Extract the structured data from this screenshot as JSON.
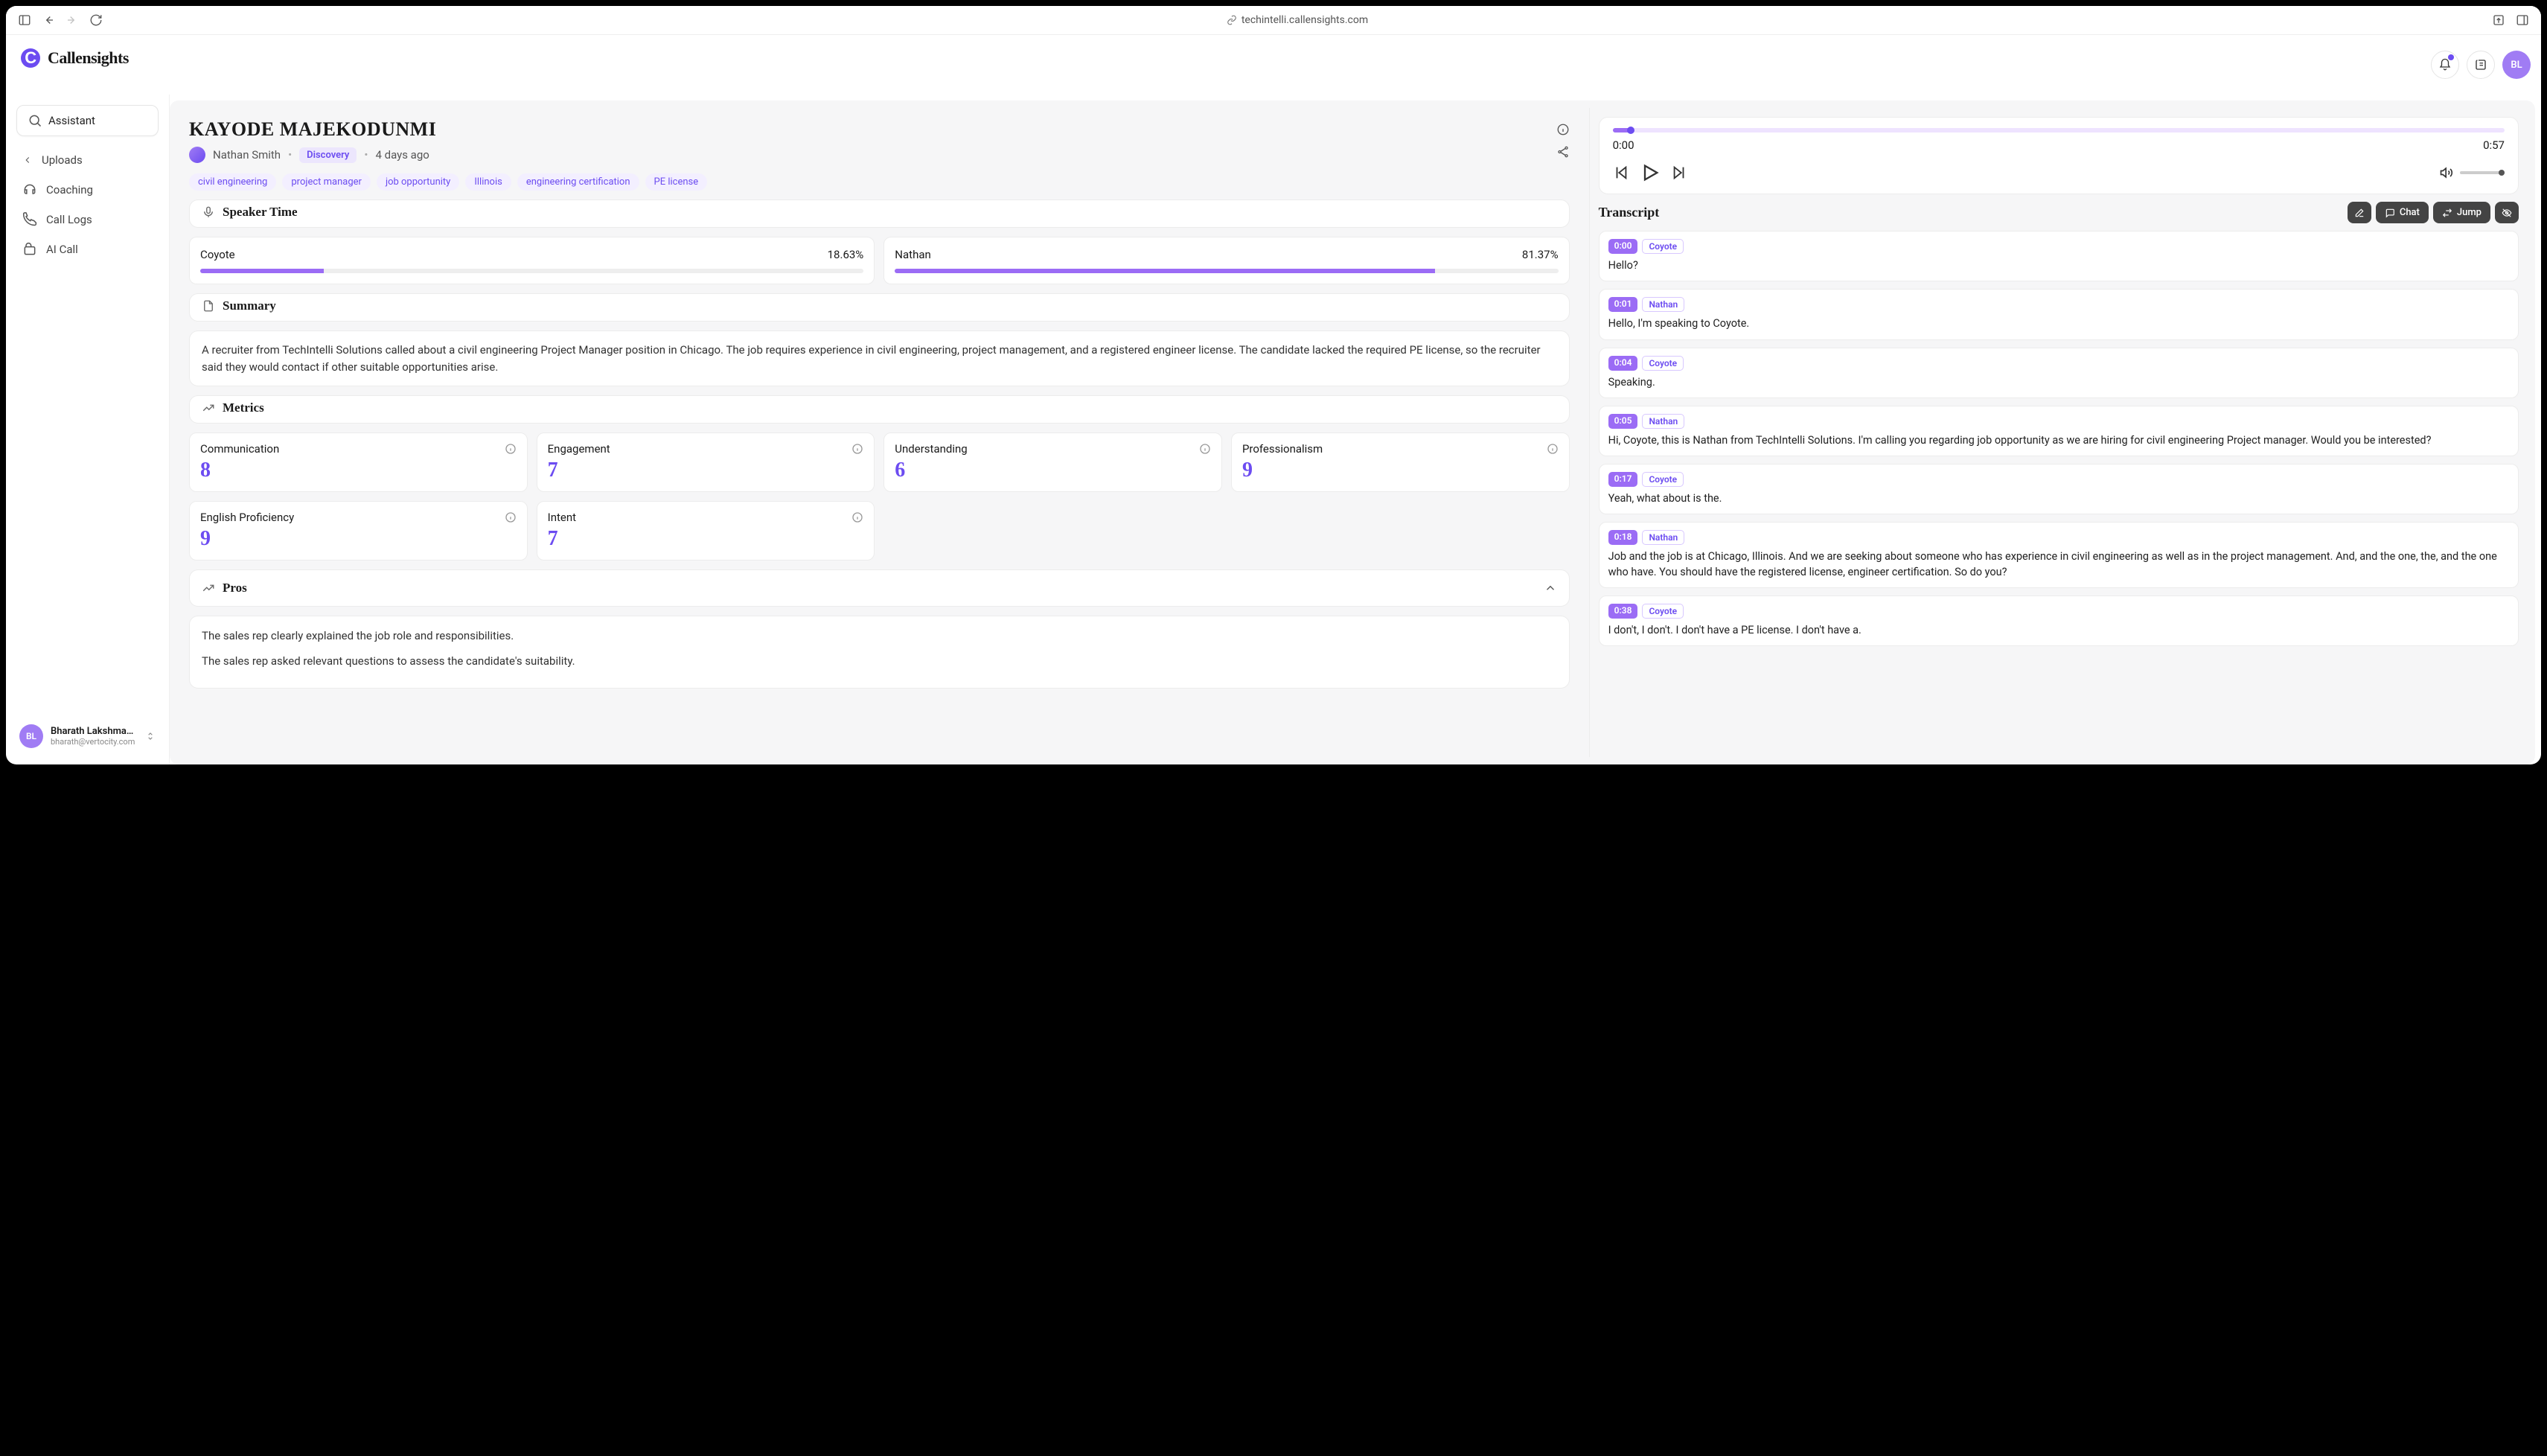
{
  "browser": {
    "url": "techintelli.callensights.com"
  },
  "brand": {
    "name": "Callensights"
  },
  "assistant_label": "Assistant",
  "sidebar": {
    "back_label": "Uploads",
    "items": [
      {
        "label": "Coaching",
        "icon": "coaching"
      },
      {
        "label": "Call Logs",
        "icon": "phone"
      },
      {
        "label": "AI Call",
        "icon": "package"
      }
    ]
  },
  "user": {
    "initials": "BL",
    "name": "Bharath Lakshman ...",
    "email": "bharath@vertocity.com"
  },
  "header_user_initials": "BL",
  "call": {
    "title": "KAYODE MAJEKODUNMI",
    "rep": "Nathan Smith",
    "type_badge": "Discovery",
    "time_ago": "4 days ago",
    "tags": [
      "civil engineering",
      "project manager",
      "job opportunity",
      "Illinois",
      "engineering certification",
      "PE license"
    ]
  },
  "speaker_time": {
    "heading": "Speaker Time",
    "speakers": [
      {
        "name": "Coyote",
        "percent": "18.63%",
        "width": 18.63
      },
      {
        "name": "Nathan",
        "percent": "81.37%",
        "width": 81.37
      }
    ]
  },
  "summary": {
    "heading": "Summary",
    "text": "A recruiter from TechIntelli Solutions called about a civil engineering Project Manager position in Chicago. The job requires experience in civil engineering, project management, and a registered engineer license. The candidate lacked the required PE license, so the recruiter said they would contact if other suitable opportunities arise."
  },
  "metrics": {
    "heading": "Metrics",
    "items": [
      {
        "label": "Communication",
        "value": "8"
      },
      {
        "label": "Engagement",
        "value": "7"
      },
      {
        "label": "Understanding",
        "value": "6"
      },
      {
        "label": "Professionalism",
        "value": "9"
      },
      {
        "label": "English Proficiency",
        "value": "9"
      },
      {
        "label": "Intent",
        "value": "7"
      }
    ]
  },
  "pros": {
    "heading": "Pros",
    "items": [
      "The sales rep clearly explained the job role and responsibilities.",
      "The sales rep asked relevant questions to assess the candidate's suitability."
    ]
  },
  "player": {
    "current": "0:00",
    "total": "0:57"
  },
  "transcript": {
    "heading": "Transcript",
    "actions": {
      "chat": "Chat",
      "jump": "Jump"
    },
    "entries": [
      {
        "time": "0:00",
        "speaker": "Coyote",
        "text": "Hello?"
      },
      {
        "time": "0:01",
        "speaker": "Nathan",
        "text": "Hello, I'm speaking to Coyote."
      },
      {
        "time": "0:04",
        "speaker": "Coyote",
        "text": "Speaking."
      },
      {
        "time": "0:05",
        "speaker": "Nathan",
        "text": "Hi, Coyote, this is Nathan from TechIntelli Solutions. I'm calling you regarding job opportunity as we are hiring for civil engineering Project manager. Would you be interested?"
      },
      {
        "time": "0:17",
        "speaker": "Coyote",
        "text": "Yeah, what about is the."
      },
      {
        "time": "0:18",
        "speaker": "Nathan",
        "text": "Job and the job is at Chicago, Illinois. And we are seeking about someone who has experience in civil engineering as well as in the project management. And, and the one, the, and the one who have. You should have the registered license, engineer certification. So do you?"
      },
      {
        "time": "0:38",
        "speaker": "Coyote",
        "text": "I don't, I don't. I don't have a PE license. I don't have a."
      }
    ]
  }
}
